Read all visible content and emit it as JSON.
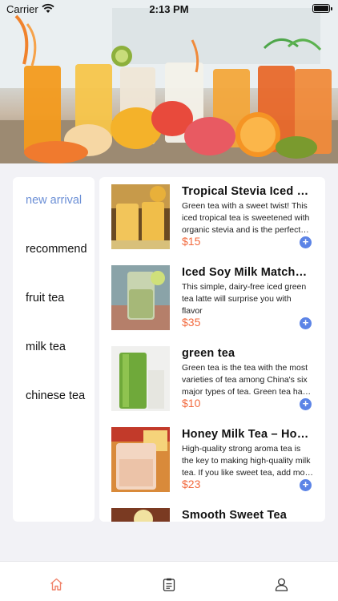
{
  "status_bar": {
    "carrier": "Carrier",
    "time": "2:13 PM"
  },
  "colors": {
    "accent": "#5c84e6",
    "active_category": "#6b8fd6",
    "price": "#f26a3e",
    "home_tab": "#f0826a"
  },
  "categories": [
    {
      "label": "new arrival",
      "active": true
    },
    {
      "label": "recommend",
      "active": false
    },
    {
      "label": "fruit tea",
      "active": false
    },
    {
      "label": "milk tea",
      "active": false
    },
    {
      "label": "chinese tea",
      "active": false
    }
  ],
  "products": [
    {
      "name": "Tropical Stevia Iced Tea",
      "description": "Green tea with a sweet twist! This iced tropical tea is sweetened with organic stevia and is the perfect summer drink",
      "price": "$15",
      "add_icon": "+"
    },
    {
      "name": "Iced Soy Milk Matcha Latte",
      "description": "This simple, dairy-free iced green tea latte will surprise you with flavor",
      "price": "$35",
      "add_icon": "+"
    },
    {
      "name": "green tea",
      "description": "Green tea is the tea with the most varieties of tea among China's six major types of tea. Green tea has a fresh taste",
      "price": "$10",
      "add_icon": "+"
    },
    {
      "name": "Honey Milk Tea – Hong Kong Style",
      "description": "High-quality strong aroma tea is the key to making high-quality milk tea. If you like sweet tea, add more honey",
      "price": "$23",
      "add_icon": "+"
    },
    {
      "name": "Smooth Sweet Tea",
      "description": "",
      "price": "",
      "add_icon": "+"
    }
  ],
  "tab_bar": [
    {
      "icon": "home-icon",
      "active": true
    },
    {
      "icon": "order-list-icon",
      "active": false
    },
    {
      "icon": "profile-icon",
      "active": false
    }
  ]
}
